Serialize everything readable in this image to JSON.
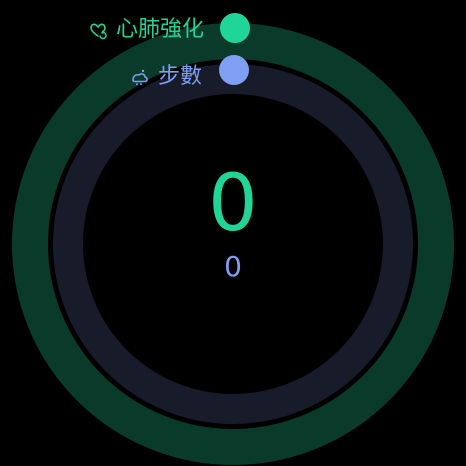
{
  "colors": {
    "background": "#000000",
    "cardio_ring": "#0a3a2a",
    "cardio_accent": "#1fd698",
    "steps_ring": "#181c2a",
    "steps_accent": "#7f9ff2"
  },
  "rings": [
    {
      "name": "心肺強化",
      "value": 0
    },
    {
      "name": "步數",
      "value": 0
    }
  ],
  "labels": {
    "cardio": {
      "text": "心肺強化",
      "icon": "heart-refresh-icon"
    },
    "steps": {
      "text": "步數",
      "icon": "steps-icon"
    }
  },
  "values": {
    "main": "0",
    "secondary": "0"
  }
}
